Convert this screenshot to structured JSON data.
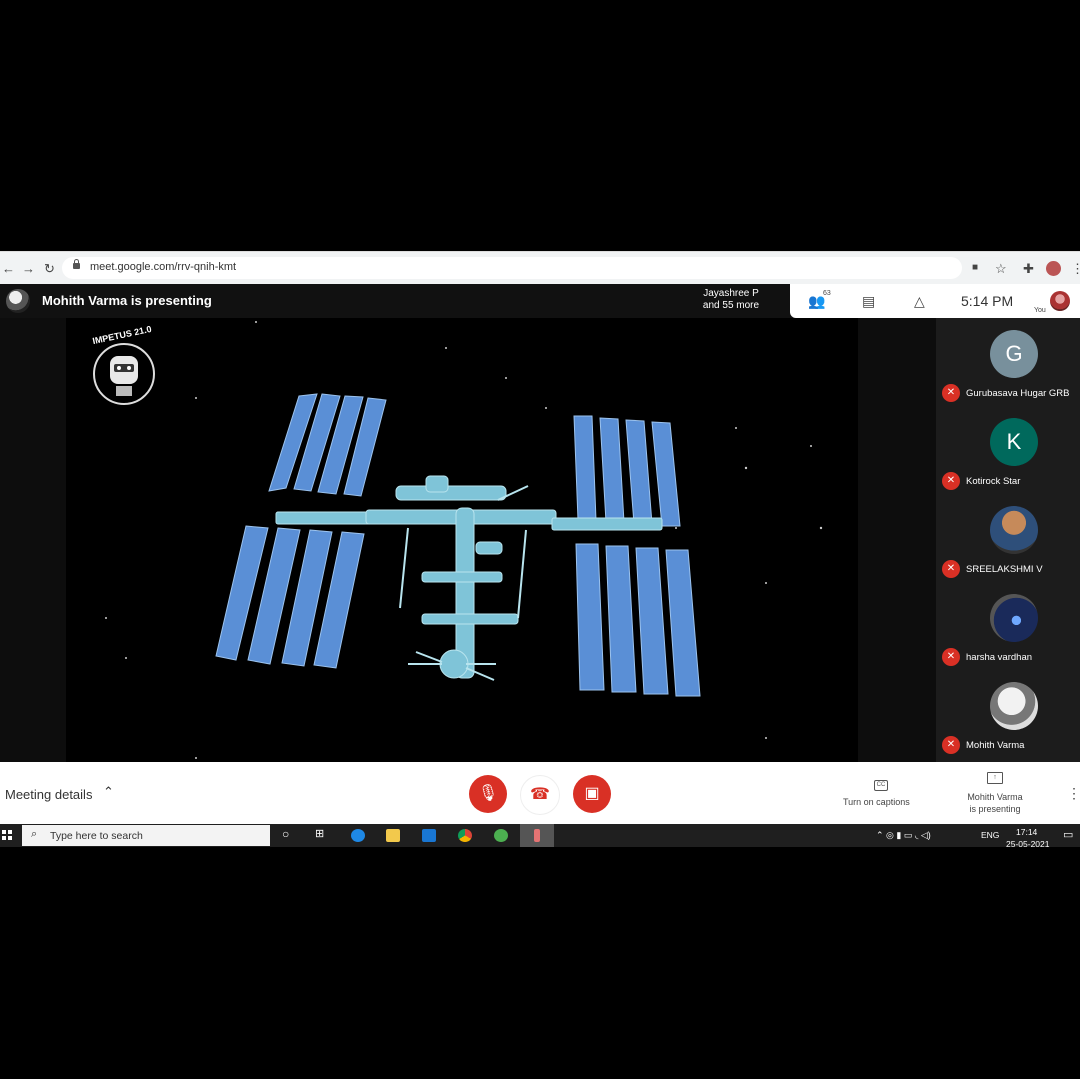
{
  "browser": {
    "url": "meet.google.com/rrv-qnih-kmt"
  },
  "header": {
    "presenting_title": "Mohith Varma is presenting",
    "others_line1": "Jayashree P",
    "others_line2": "and 55 more",
    "participant_count": "63",
    "time": "5:14 PM",
    "you_label": "You"
  },
  "presentation": {
    "logo_text": "IMPETUS 21.0"
  },
  "participants": [
    {
      "name": "Gurubasava Hugar GRB",
      "initial": "G",
      "color": "#78909c",
      "muted": true
    },
    {
      "name": "Kotirock Star",
      "initial": "K",
      "color": "#00695c",
      "muted": true
    },
    {
      "name": "SREELAKSHMI V",
      "initial": "",
      "color": "#a36a3a",
      "muted": true
    },
    {
      "name": "harsha vardhan",
      "initial": "",
      "color": "#2b3a6b",
      "muted": true
    },
    {
      "name": "Mohith Varma",
      "initial": "",
      "color": "#cfcfcf",
      "muted": true
    }
  ],
  "bottom": {
    "meeting_details": "Meeting details",
    "captions_label": "Turn on captions",
    "presenting_line1": "Mohith Varma",
    "presenting_line2": "is presenting"
  },
  "taskbar": {
    "search_placeholder": "Type here to search",
    "lang": "ENG",
    "clock_time": "17:14",
    "clock_date": "25-05-2021"
  },
  "colors": {
    "red": "#d93025",
    "panel": "#cfe3f8"
  }
}
